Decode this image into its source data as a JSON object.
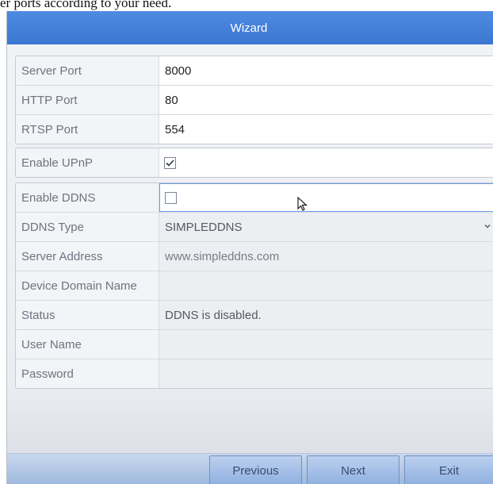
{
  "caption": "er ports according to your need.",
  "window": {
    "title": "Wizard"
  },
  "ports": {
    "server_port": {
      "label": "Server Port",
      "value": "8000"
    },
    "http_port": {
      "label": "HTTP Port",
      "value": "80"
    },
    "rtsp_port": {
      "label": "RTSP Port",
      "value": "554"
    }
  },
  "upnp": {
    "label": "Enable UPnP",
    "checked": true
  },
  "ddns": {
    "enable_label": "Enable DDNS",
    "enabled": false,
    "type_label": "DDNS Type",
    "type_value": "SIMPLEDDNS",
    "server_address_label": "Server Address",
    "server_address_value": "www.simpleddns.com",
    "domain_label": "Device Domain Name",
    "domain_value": "",
    "status_label": "Status",
    "status_value": "DDNS is disabled.",
    "username_label": "User Name",
    "username_value": "",
    "password_label": "Password",
    "password_value": ""
  },
  "buttons": {
    "previous": "Previous",
    "next": "Next",
    "exit": "Exit"
  },
  "icons": {
    "check": "check-icon",
    "dropdown": "chevron-down-icon",
    "cursor": "mouse-pointer-icon"
  },
  "colors": {
    "titlebar": "#3b76d0",
    "button": "#9fb8dd"
  }
}
